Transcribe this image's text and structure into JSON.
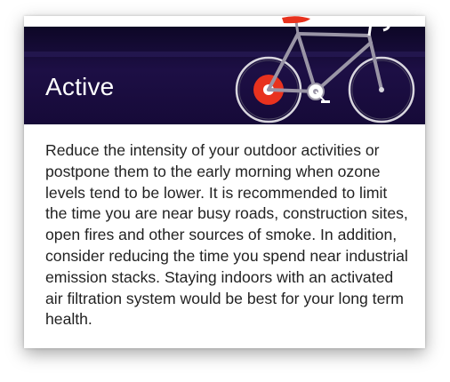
{
  "card": {
    "title": "Active",
    "description": "Reduce the intensity of your outdoor activities or postpone them to the early morning when ozone levels tend to be lower. It is recommended to limit the time you are near busy roads, construction sites, open fires and other sources of smoke. In addition, consider reducing the time you spend near industrial emission stacks. Staying indoors with an activated air filtration system would be best for your long term health."
  },
  "colors": {
    "banner": "#160a38",
    "bike_frame": "#9a95a6",
    "accent_red": "#e8321e"
  },
  "icons": {
    "banner_illustration": "bicycle-icon"
  }
}
